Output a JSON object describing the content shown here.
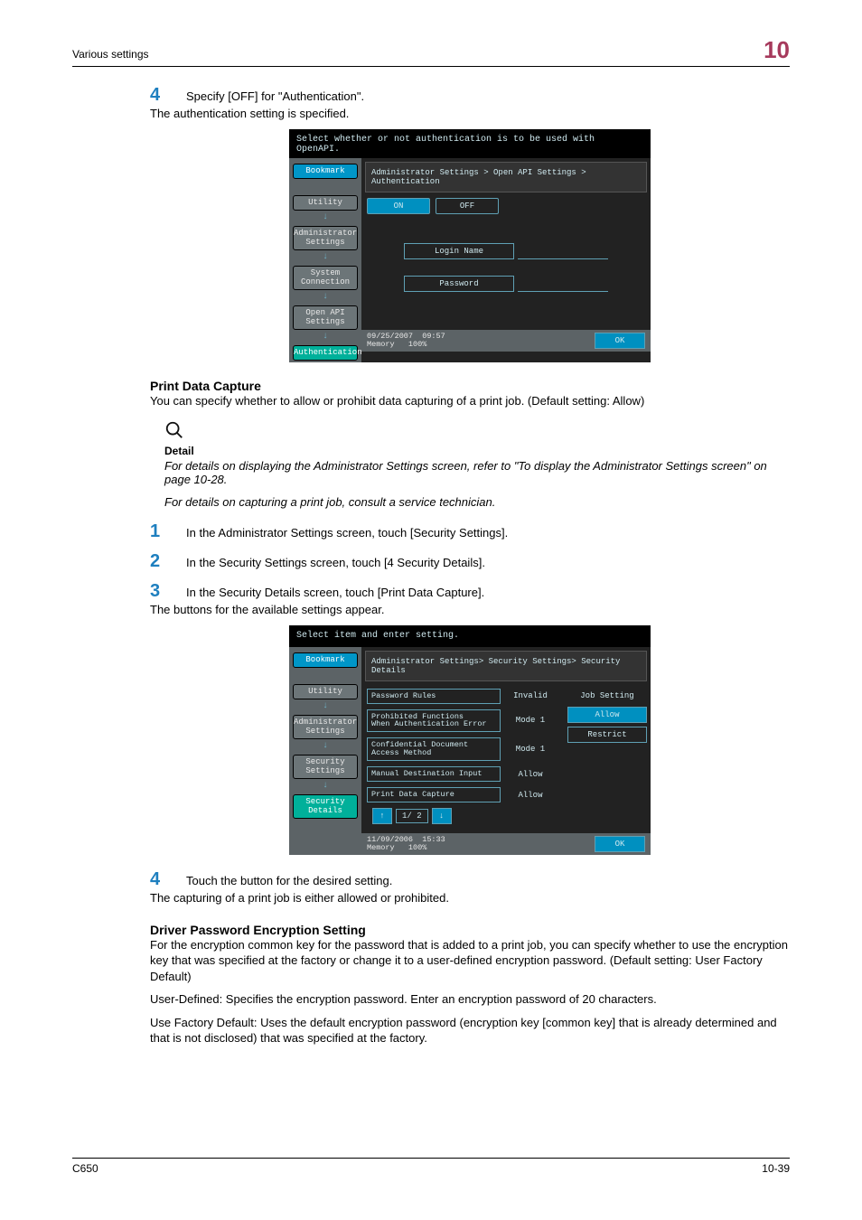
{
  "header": {
    "section": "Various settings",
    "chapter": "10"
  },
  "footer": {
    "model": "C650",
    "page": "10-39"
  },
  "auth_section": {
    "step4": {
      "num": "4",
      "line": "Specify [OFF] for \"Authentication\".",
      "sub": "The authentication setting is specified."
    }
  },
  "scr1": {
    "topline": "Select whether or not authentication is to be used with OpenAPI.",
    "side": {
      "bookmark": "Bookmark",
      "utility": "Utility",
      "admin": "Administrator\nSettings",
      "system": "System\nConnection",
      "openapi": "Open API\nSettings",
      "auth": "Authentication"
    },
    "crumb": "Administrator Settings > Open API Settings > Authentication",
    "tabs": {
      "on": "ON",
      "off": "OFF"
    },
    "fields": {
      "login": "Login Name",
      "password": "Password"
    },
    "foot": {
      "date": "09/25/2007",
      "time": "09:57",
      "memlabel": "Memory",
      "mem": "100%",
      "ok": "OK"
    }
  },
  "pdc_section": {
    "heading": "Print Data Capture",
    "intro": "You can specify whether to allow or prohibit data capturing of a print job. (Default setting: Allow)",
    "detail_label": "Detail",
    "detail1": "For details on displaying the Administrator Settings screen, refer to \"To display the Administrator Settings screen\" on page 10-28.",
    "detail2": "For details on capturing a print job, consult a service technician.",
    "step1": {
      "num": "1",
      "line": "In the Administrator Settings screen, touch [Security Settings]."
    },
    "step2": {
      "num": "2",
      "line": "In the Security Settings screen, touch [4 Security Details]."
    },
    "step3": {
      "num": "3",
      "line": "In the Security Details screen, touch [Print Data Capture].",
      "sub": "The buttons for the available settings appear."
    }
  },
  "scr2": {
    "topline": "Select item and enter setting.",
    "side": {
      "bookmark": "Bookmark",
      "utility": "Utility",
      "admin": "Administrator\nSettings",
      "security": "Security\nSettings",
      "secdetails": "Security Details"
    },
    "crumb": "Administrator Settings> Security Settings> Security Details",
    "rows": [
      {
        "name": "Password Rules",
        "val": "Invalid"
      },
      {
        "name": "Prohibited Functions\nWhen Authentication Error",
        "val": "Mode 1"
      },
      {
        "name": "Confidential Document\nAccess Method",
        "val": "Mode 1"
      },
      {
        "name": "Manual Destination Input",
        "val": "Allow"
      },
      {
        "name": "Print Data Capture",
        "val": "Allow"
      }
    ],
    "jobsetting": {
      "head": "Job Setting",
      "allow": "Allow",
      "restrict": "Restrict"
    },
    "pager": {
      "up": "↑",
      "pg": "1/ 2",
      "dn": "↓"
    },
    "foot": {
      "date": "11/09/2006",
      "time": "15:33",
      "memlabel": "Memory",
      "mem": "100%",
      "ok": "OK"
    }
  },
  "after_scr2": {
    "step4": {
      "num": "4",
      "line": "Touch the button for the desired setting.",
      "sub": "The capturing of a print job is either allowed or prohibited."
    }
  },
  "driver_section": {
    "heading": "Driver Password Encryption Setting",
    "p1": "For the encryption common key for the password that is added to a print job, you can specify whether to use the encryption key that was specified at the factory or change it to a user-defined encryption password. (Default setting: User Factory Default)",
    "p2": "User-Defined: Specifies the encryption password. Enter an encryption password of 20 characters.",
    "p3": "Use Factory Default: Uses the default encryption password (encryption key [common key] that is already determined and that is not disclosed) that was specified at the factory."
  }
}
